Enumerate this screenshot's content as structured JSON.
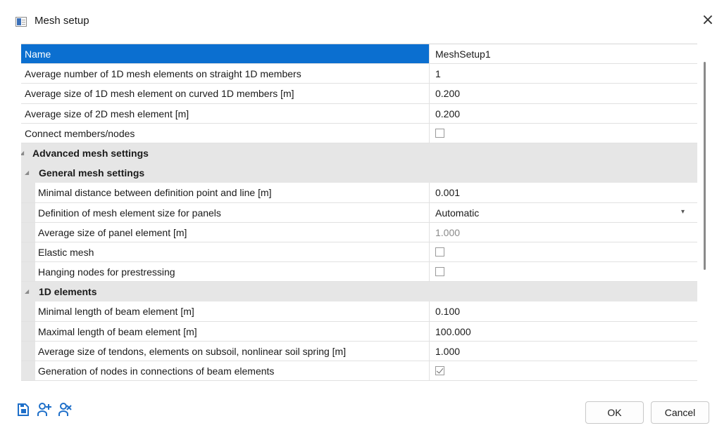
{
  "window": {
    "title": "Mesh setup",
    "close_glyph": "×"
  },
  "grid": {
    "rows": [
      {
        "label": "Name",
        "value": "MeshSetup1",
        "selected": true
      },
      {
        "label": "Average number of 1D mesh elements on straight 1D members",
        "value": "1"
      },
      {
        "label": "Average size of 1D mesh element on curved 1D members [m]",
        "value": "0.200"
      },
      {
        "label": "Average size of 2D mesh element [m]",
        "value": "0.200"
      },
      {
        "label": "Connect members/nodes",
        "value": "",
        "checkbox": false
      },
      {
        "group": "Advanced mesh settings",
        "expanded": true
      },
      {
        "group": "General mesh settings",
        "expanded": true
      },
      {
        "label": "Minimal distance between definition point and line [m]",
        "value": "0.001"
      },
      {
        "label": "Definition of mesh element size for panels",
        "value": "Automatic",
        "dropdown": true
      },
      {
        "label": "Average size of panel element [m]",
        "value": "1.000",
        "disabled": true
      },
      {
        "label": "Elastic mesh",
        "checkbox": false
      },
      {
        "label": "Hanging nodes for prestressing",
        "checkbox": false
      },
      {
        "group": "1D elements",
        "expanded": true
      },
      {
        "label": "Minimal length of beam element [m]",
        "value": "0.100"
      },
      {
        "label": "Maximal length of beam element [m]",
        "value": "100.000"
      },
      {
        "label": "Average size of tendons, elements on subsoil, nonlinear soil spring [m]",
        "value": "1.000"
      },
      {
        "label": "Generation of nodes in connections of beam elements",
        "checkbox": true
      }
    ]
  },
  "footer": {
    "icons": [
      "save-to-library-icon",
      "add-user-icon",
      "user-settings-icon"
    ],
    "ok_label": "OK",
    "cancel_label": "Cancel"
  },
  "colors": {
    "selection": "#0b6fd0",
    "group_background": "#e6e6e6"
  }
}
